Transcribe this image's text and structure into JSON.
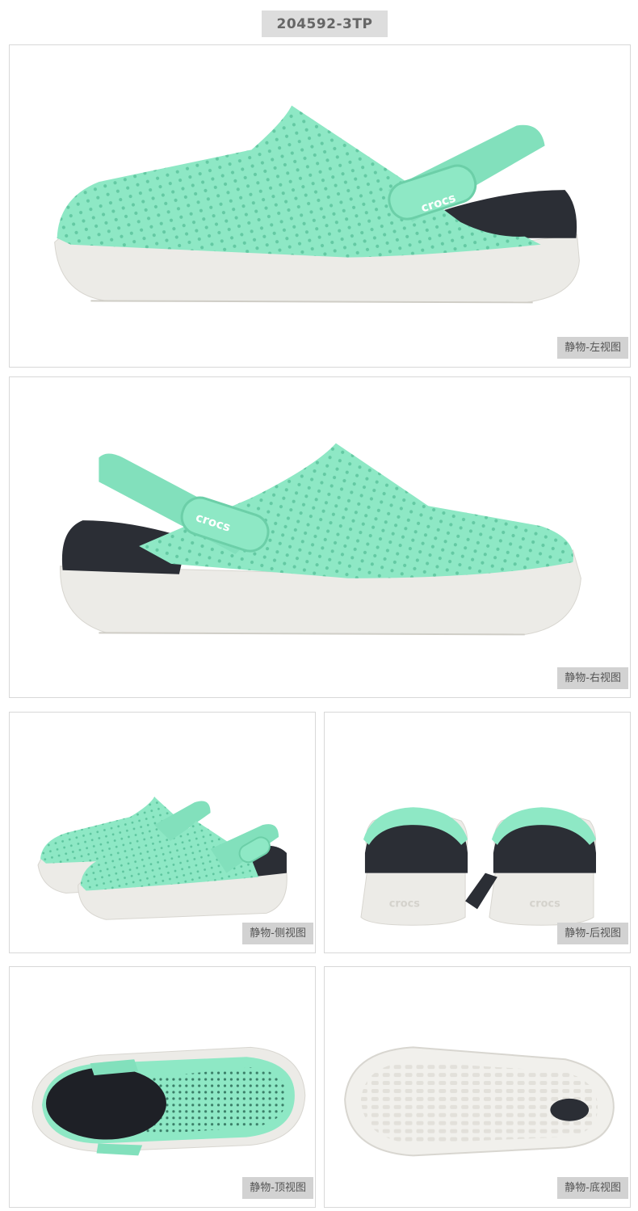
{
  "header": {
    "sku": "204592-3TP"
  },
  "colors": {
    "upper": "#8ee8c5",
    "upper_shade": "#74d8b2",
    "sole": "#ecebe7",
    "liner": "#2b2e35",
    "tag_bg": "#d2d2d2"
  },
  "panels": [
    {
      "id": "left",
      "label": "静物-左视图",
      "logo": "crocs"
    },
    {
      "id": "right",
      "label": "静物-右视图",
      "logo": "crocs"
    },
    {
      "id": "side",
      "label": "静物-侧视图"
    },
    {
      "id": "back",
      "label": "静物-后视图",
      "logo": "crocs"
    },
    {
      "id": "top",
      "label": "静物-顶视图"
    },
    {
      "id": "bottom",
      "label": "静物-底视图"
    }
  ]
}
